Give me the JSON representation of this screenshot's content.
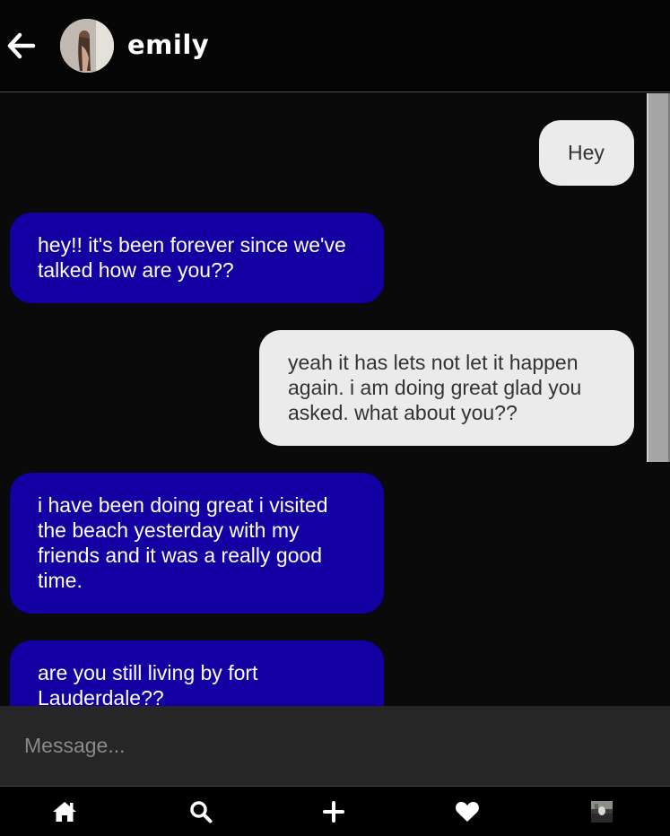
{
  "header": {
    "contact_name": "emily",
    "back_icon": "arrow-left-icon",
    "avatar_icon": "contact-avatar"
  },
  "messages": [
    {
      "direction": "outgoing",
      "text": "Hey"
    },
    {
      "direction": "incoming",
      "text": "hey!! it's been forever since we've talked how are you??"
    },
    {
      "direction": "outgoing",
      "text": "yeah it has lets not let it happen again. i am doing great glad you asked. what about you??"
    },
    {
      "direction": "incoming",
      "text": "i have been doing great i visited the beach yesterday with my friends and it was a really good time."
    },
    {
      "direction": "incoming",
      "text": "are you still living by fort Lauderdale??"
    }
  ],
  "composer": {
    "placeholder": "Message...",
    "value": ""
  },
  "nav": {
    "items": [
      "home-icon",
      "search-icon",
      "plus-icon",
      "heart-icon",
      "profile-avatar"
    ]
  },
  "colors": {
    "incoming_bubble": "#1200a3",
    "outgoing_bubble": "#ebebeb",
    "background": "#0a0a0a",
    "composer": "#262626"
  }
}
